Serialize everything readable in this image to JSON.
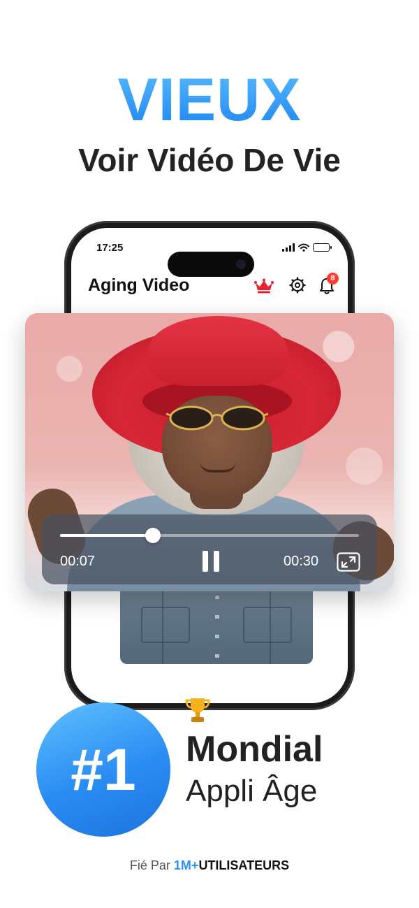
{
  "headline": "VIEUX",
  "subheadline": "Voir Vidéo De Vie",
  "phone": {
    "status_time": "17:25",
    "app_title": "Aging Video",
    "notification_count": "8",
    "icons": [
      "crown-icon",
      "gear-icon",
      "bell-icon",
      "signal-icon",
      "wifi-icon",
      "battery-icon"
    ]
  },
  "player": {
    "current_time": "00:07",
    "total_time": "00:30",
    "progress": 0.31,
    "state": "playing",
    "icons": [
      "pause-icon",
      "fullscreen-icon"
    ]
  },
  "award": {
    "rank": "#1",
    "title": "Mondial",
    "subtitle": "Appli Âge",
    "icon": "trophy-icon"
  },
  "trust": {
    "prefix": "Fié Par ",
    "count": "1M+",
    "users": "UTILISATEURS"
  },
  "colors": {
    "accent_blue": "#2f9cf6",
    "crown_red": "#e8232f",
    "badge_red": "#ff3b30"
  }
}
